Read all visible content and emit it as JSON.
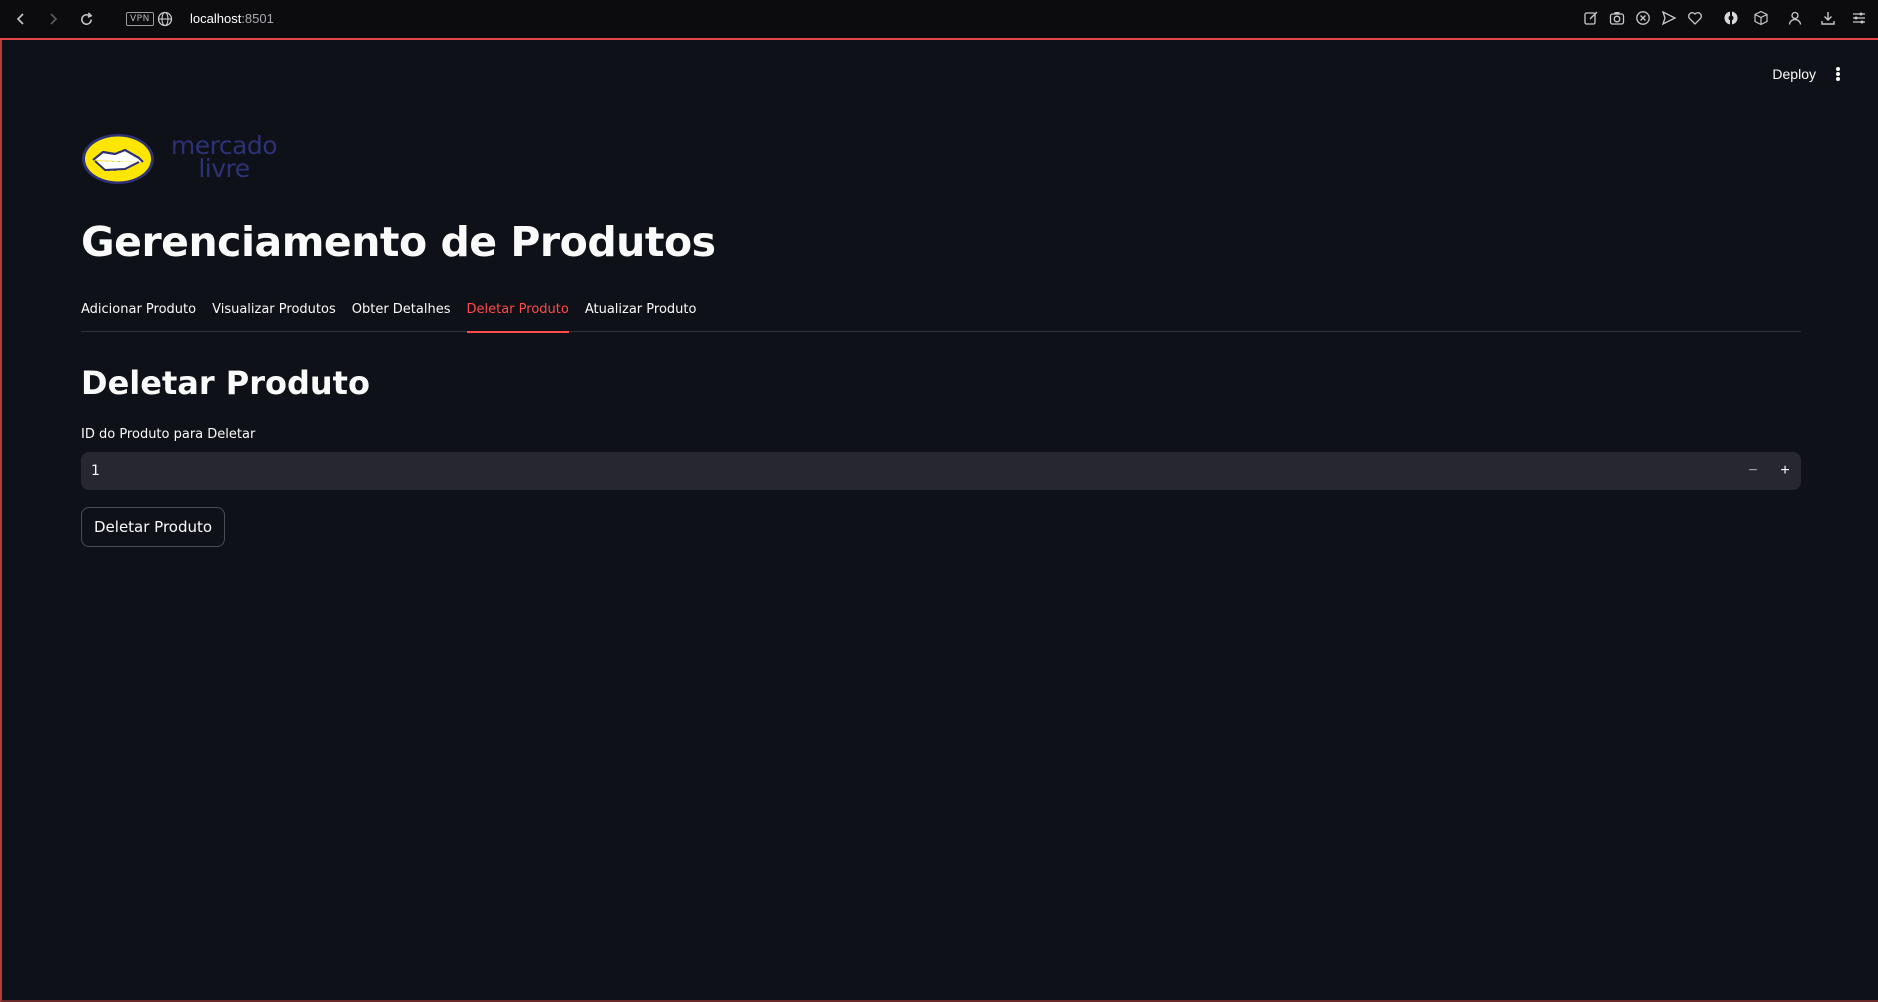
{
  "browser": {
    "vpn_label": "VPN",
    "url_host": "localhost",
    "url_port": ":8501",
    "icons": [
      "back-icon",
      "forward-icon",
      "reload-icon",
      "globe-icon",
      "edit-icon",
      "camera-icon",
      "shield-icon",
      "send-icon",
      "heart-icon",
      "extension-icon",
      "cube-icon",
      "profile-icon",
      "download-icon",
      "menu-icon"
    ]
  },
  "app": {
    "deploy_label": "Deploy",
    "logo_line1": "mercado",
    "logo_line2": "livre",
    "title": "Gerenciamento de Produtos",
    "tabs": [
      {
        "label": "Adicionar Produto",
        "active": false
      },
      {
        "label": "Visualizar Produtos",
        "active": false
      },
      {
        "label": "Obter Detalhes",
        "active": false
      },
      {
        "label": "Deletar Produto",
        "active": true
      },
      {
        "label": "Atualizar Produto",
        "active": false
      }
    ],
    "section_title": "Deletar Produto",
    "field_label": "ID do Produto para Deletar",
    "field_value": "1",
    "stepper_minus": "−",
    "stepper_plus": "+",
    "submit_label": "Deletar Produto"
  },
  "colors": {
    "background": "#0e1117",
    "accent": "#ff4b4b",
    "input_bg": "#262730",
    "logo_yellow": "#ffe600",
    "logo_blue": "#2d3277"
  }
}
